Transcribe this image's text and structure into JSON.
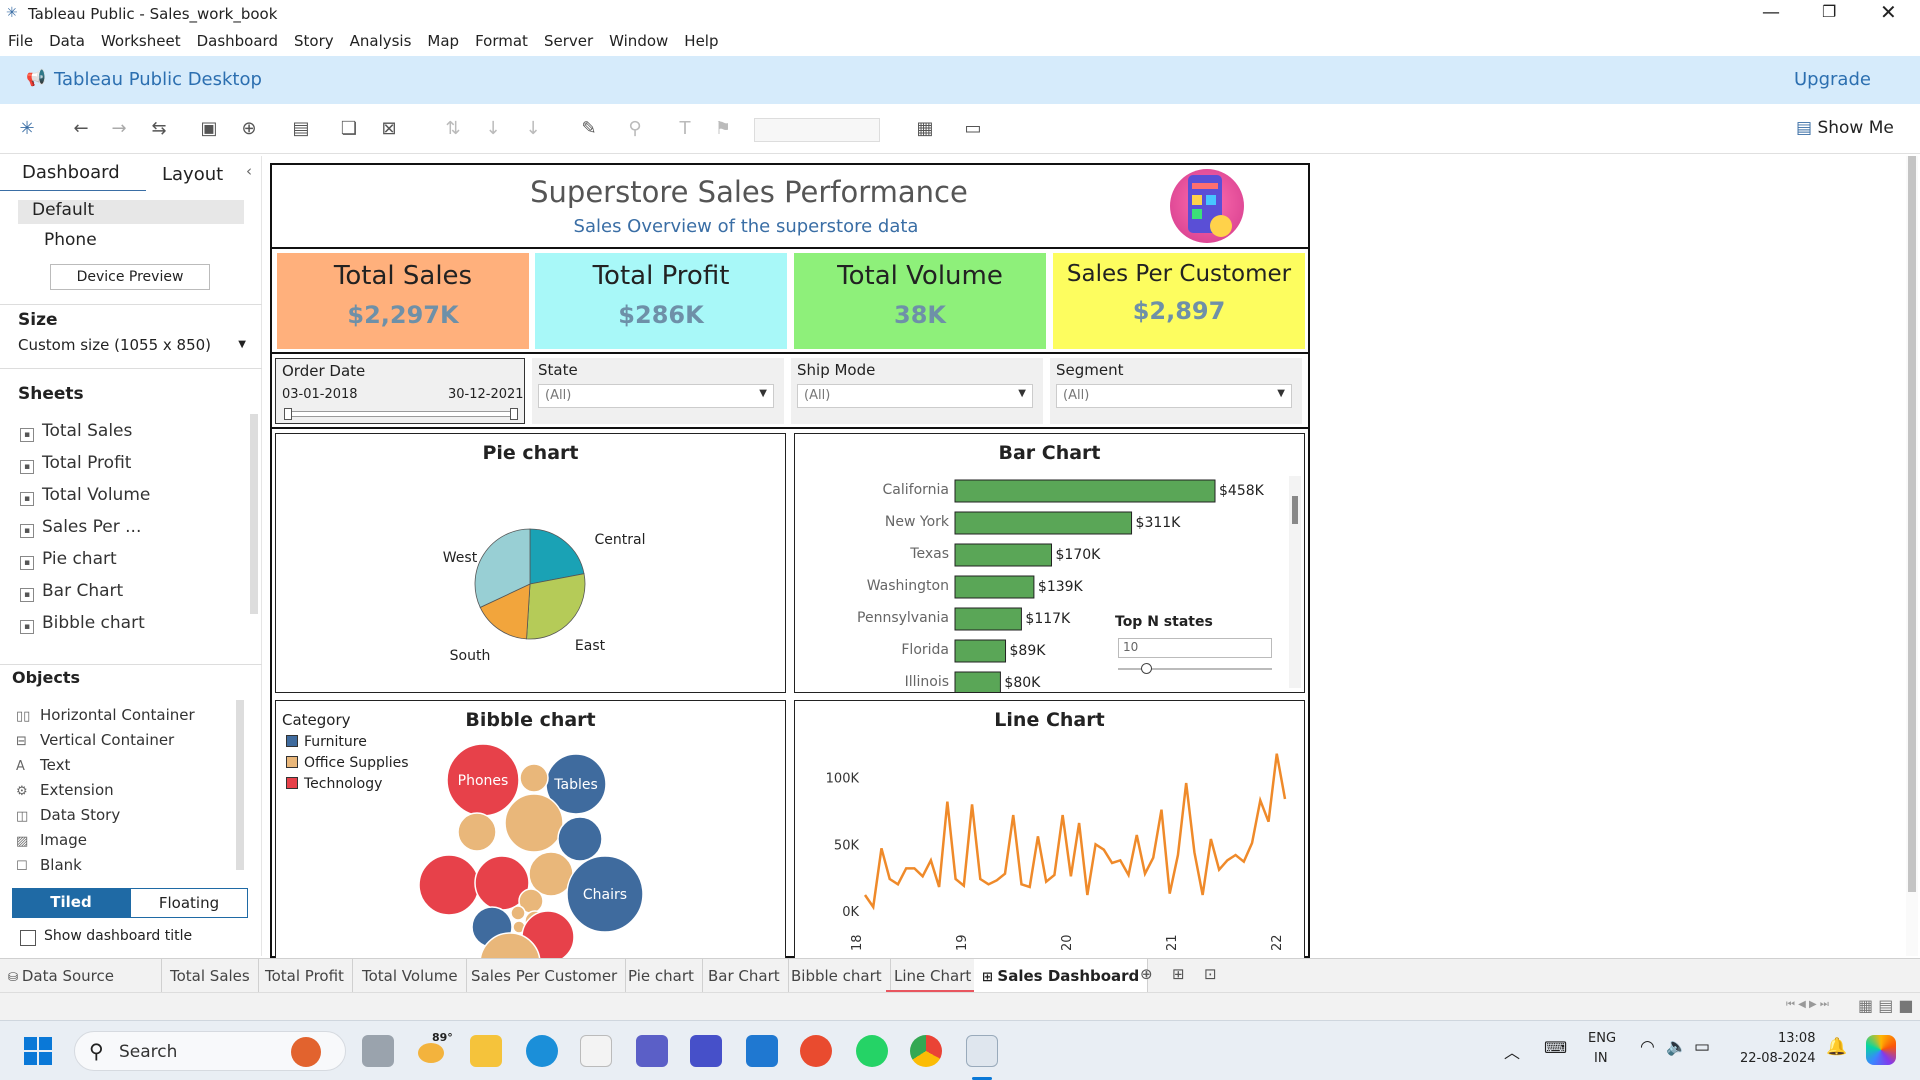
{
  "window": {
    "title": "Tableau Public - Sales_work_book"
  },
  "menu": [
    "File",
    "Data",
    "Worksheet",
    "Dashboard",
    "Story",
    "Analysis",
    "Map",
    "Format",
    "Server",
    "Window",
    "Help"
  ],
  "banner": {
    "product": "Tableau Public Desktop",
    "upgrade": "Upgrade"
  },
  "toolbar": {
    "show_me": "Show Me"
  },
  "left_panel": {
    "tab_dashboard": "Dashboard",
    "tab_layout": "Layout",
    "device_default": "Default",
    "device_phone": "Phone",
    "device_preview": "Device Preview",
    "size_heading": "Size",
    "size_value": "Custom size (1055 x 850)",
    "sheets_heading": "Sheets",
    "sheets": [
      "Total Sales",
      "Total Profit",
      "Total Volume",
      "Sales Per ...",
      "Pie chart",
      "Bar Chart",
      "Bibble chart"
    ],
    "objects_heading": "Objects",
    "objects": [
      "Horizontal Container",
      "Vertical Container",
      "Text",
      "Extension",
      "Data Story",
      "Image",
      "Blank"
    ],
    "tiled": "Tiled",
    "floating": "Floating",
    "show_title": "Show dashboard title"
  },
  "dashboard": {
    "title": "Superstore Sales Performance",
    "subtitle": "Sales Overview of the superstore data",
    "kpis": [
      {
        "title": "Total Sales",
        "value": "$2,297K",
        "color": "#ffb07c"
      },
      {
        "title": "Total Profit",
        "value": "$286K",
        "color": "#a8f8f8"
      },
      {
        "title": "Total Volume",
        "value": "38K",
        "color": "#8ef07a"
      },
      {
        "title": "Sales Per Customer",
        "value": "$2,897",
        "color": "#fdfd5f"
      }
    ],
    "filters": {
      "order_date_label": "Order Date",
      "date_start": "03-01-2018",
      "date_end": "30-12-2021",
      "state_label": "State",
      "state_value": "(All)",
      "shipmode_label": "Ship Mode",
      "shipmode_value": "(All)",
      "segment_label": "Segment",
      "segment_value": "(All)"
    },
    "pie": {
      "title": "Pie chart",
      "slices": [
        {
          "label": "Central",
          "value": 22.0,
          "color": "#1aa2b5"
        },
        {
          "label": "East",
          "value": 29.0,
          "color": "#b5cb58"
        },
        {
          "label": "South",
          "value": 17.0,
          "color": "#f2a53c"
        },
        {
          "label": "West",
          "value": 32.0,
          "color": "#98cfd4"
        }
      ]
    },
    "bar": {
      "title": "Bar Chart",
      "categories": [
        "California",
        "New York",
        "Texas",
        "Washington",
        "Pennsylvania",
        "Florida",
        "Illinois"
      ],
      "values": [
        458,
        311,
        170,
        139,
        117,
        89,
        80
      ],
      "labels": [
        "$458K",
        "$311K",
        "$170K",
        "$139K",
        "$117K",
        "$89K",
        "$80K"
      ],
      "color": "#5aa657",
      "topn_label": "Top N states",
      "topn_value": "10"
    },
    "bubble": {
      "title": "Bibble chart",
      "legend_title": "Category",
      "legend": [
        {
          "name": "Furniture",
          "color": "#3f6b9e"
        },
        {
          "name": "Office Supplies",
          "color": "#e9b77a"
        },
        {
          "name": "Technology",
          "color": "#e7414a"
        }
      ],
      "bubble_labels": {
        "phones": "Phones",
        "tables": "Tables",
        "chairs": "Chairs"
      }
    },
    "line": {
      "title": "Line Chart",
      "y_ticks": [
        "100K",
        "50K",
        "0K"
      ],
      "x_ticks": [
        "18",
        "19",
        "20",
        "21",
        "22"
      ],
      "color": "#ef8a2a",
      "values": [
        12,
        3,
        47,
        24,
        20,
        32,
        32,
        26,
        38,
        18,
        82,
        24,
        19,
        80,
        24,
        20,
        23,
        28,
        72,
        20,
        18,
        56,
        22,
        27,
        72,
        26,
        66,
        12,
        50,
        46,
        36,
        38,
        27,
        57,
        28,
        40,
        76,
        13,
        42,
        96,
        44,
        12,
        54,
        31,
        38,
        42,
        37,
        51,
        83,
        67,
        118,
        84
      ]
    }
  },
  "tabs": [
    "Data Source",
    "Total Sales",
    "Total Profit",
    "Total Volume",
    "Sales Per Customer",
    "Pie chart",
    "Bar Chart",
    "Bibble chart",
    "Line Chart",
    "Sales Dashboard"
  ],
  "taskbar": {
    "search": "Search",
    "weather": "89°",
    "lang1": "ENG",
    "lang2": "IN",
    "time": "13:08",
    "date": "22-08-2024"
  }
}
